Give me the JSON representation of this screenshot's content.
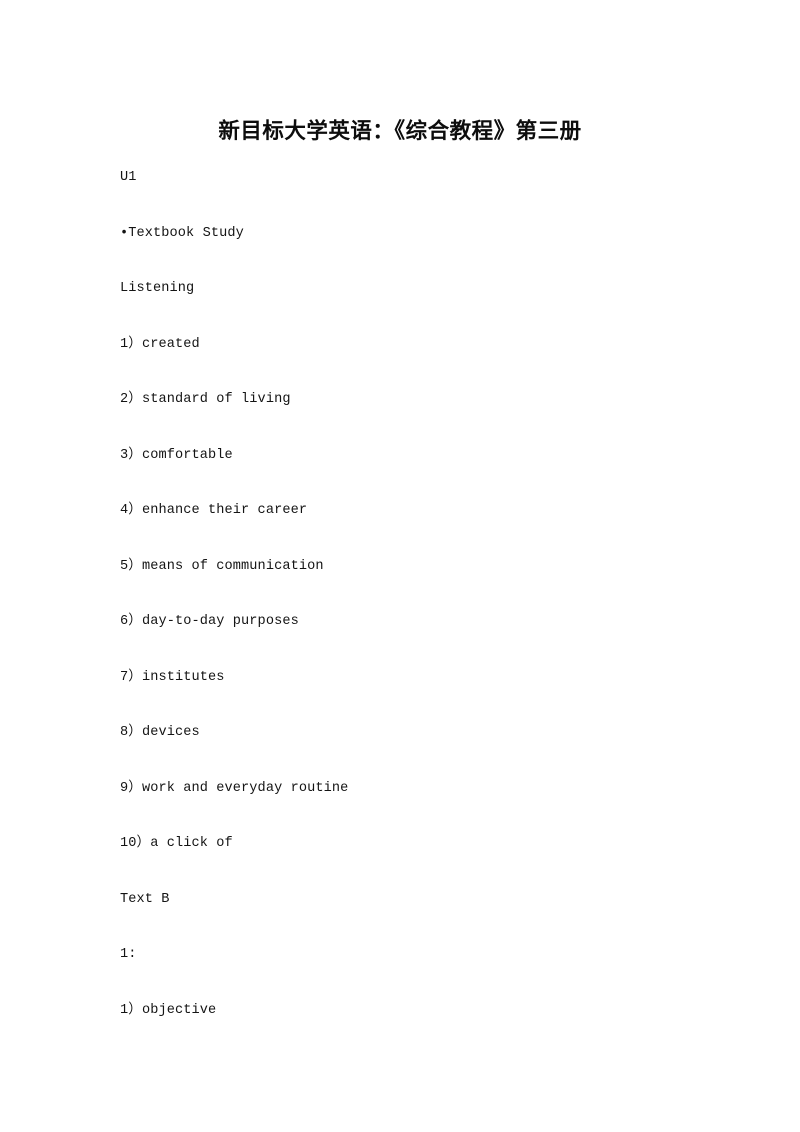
{
  "document": {
    "title": "新目标大学英语：《综合教程》第三册",
    "paragraphs": [
      {
        "text": "U1"
      },
      {
        "text": "•Textbook Study"
      },
      {
        "text": "Listening"
      },
      {
        "text": "1）created"
      },
      {
        "text": "2）standard of living"
      },
      {
        "text": "3）comfortable"
      },
      {
        "text": "4）enhance their career"
      },
      {
        "text": "5）means of communication"
      },
      {
        "text": "6）day-to-day purposes"
      },
      {
        "text": "7）institutes"
      },
      {
        "text": "8）devices"
      },
      {
        "text": "9）work and everyday routine"
      },
      {
        "text": "10）a click of"
      },
      {
        "text": "Text B"
      },
      {
        "text": "1:"
      },
      {
        "text": "1）objective"
      }
    ]
  }
}
